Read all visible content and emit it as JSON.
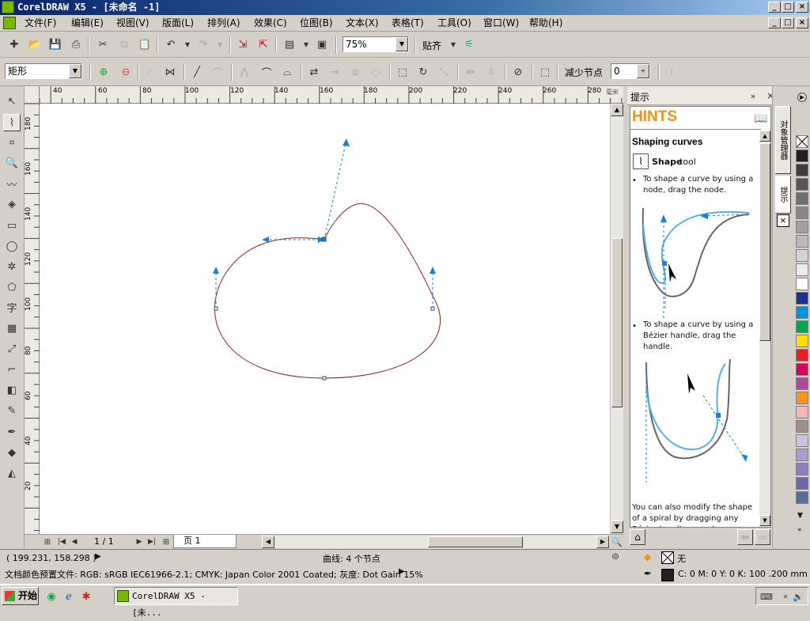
{
  "window": {
    "title": "CorelDRAW X5 - [未命名 -1]"
  },
  "menu": [
    "文件(F)",
    "编辑(E)",
    "视图(V)",
    "版面(L)",
    "排列(A)",
    "效果(C)",
    "位图(B)",
    "文本(X)",
    "表格(T)",
    "工具(O)",
    "窗口(W)",
    "帮助(H)"
  ],
  "toolbar": {
    "zoom_value": "75%",
    "snap_label": "贴齐"
  },
  "propbar": {
    "shape_combo": "矩形",
    "reduce_nodes_label": "减少节点",
    "reduce_nodes_value": "0"
  },
  "ruler": {
    "top_labels": [
      "40",
      "60",
      "80",
      "100",
      "120",
      "140",
      "160",
      "180",
      "200",
      "220",
      "240",
      "260",
      "280"
    ],
    "unit": "毫米",
    "left_labels": [
      "180",
      "160",
      "140",
      "120",
      "100",
      "80",
      "60",
      "40",
      "20"
    ]
  },
  "pagenav": {
    "page_count": "1 / 1",
    "page_tab": "页 1"
  },
  "docker": {
    "title": "提示",
    "hints_heading": "HINTS",
    "section_title": "Shaping curves",
    "tool_name": "Shape",
    "tool_suffix": "tool",
    "bullet1": "To shape a curve by using a node, drag the node.",
    "bullet2": "To shape a curve by using a Bézier handle, drag the handle.",
    "paragraph": "You can also modify the shape of a spiral by dragging any Bézier handle or node."
  },
  "dock_tabs": {
    "object_manager": "对象管理器",
    "hints": "提示"
  },
  "status": {
    "coords": "( 199.231, 158.298 )",
    "object_info": "曲线: 4 个节点",
    "fill_none": "无",
    "color_profile": "文档颜色预置文件: RGB: sRGB IEC61966-2.1; CMYK: Japan Color 2001 Coated; 灰度: Dot Gain 15%",
    "outline_info": "C: 0 M: 0 Y: 0 K: 100  .200 mm"
  },
  "taskbar": {
    "start": "开始",
    "task": "CorelDRAW X5 - [未..."
  },
  "palette_colors": [
    "#231f20",
    "#3c3c3c",
    "#555555",
    "#6e6e6e",
    "#878787",
    "#a0a0a0",
    "#b9b9b9",
    "#d2d2d2",
    "#ebebeb",
    "#ffffff",
    "#1b2f8c",
    "#0095da",
    "#00a651",
    "#ffde00",
    "#ed1c24",
    "#d6005d",
    "#b0489a",
    "#f7941d",
    "#f4b6b6",
    "#9e8f87",
    "#cbc4de",
    "#a99dcd",
    "#8c7fbf",
    "#7166a9",
    "#5b6b9a"
  ]
}
